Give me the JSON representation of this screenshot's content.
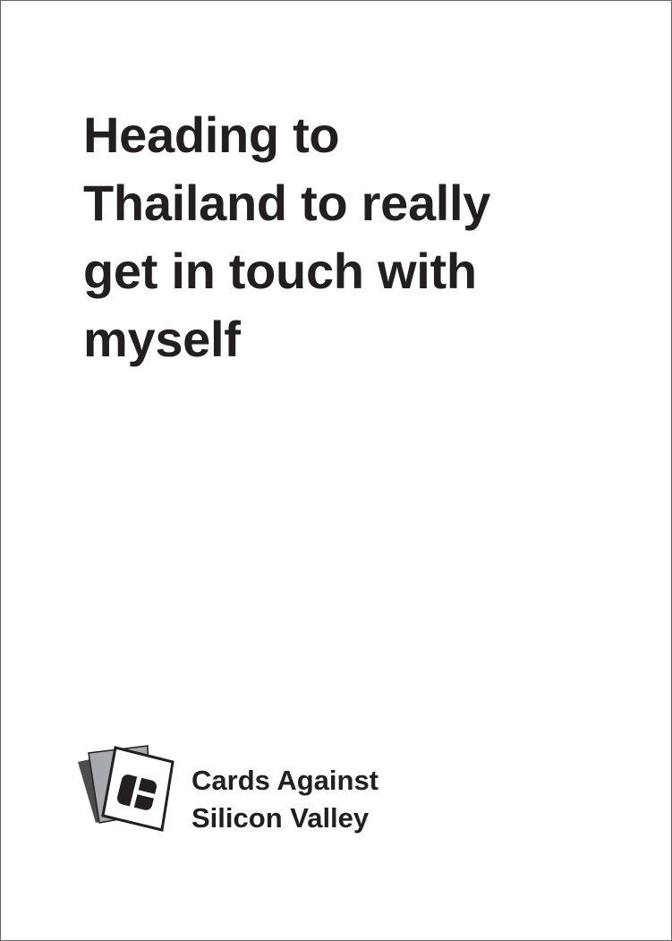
{
  "card": {
    "text_lines": [
      "Heading to",
      "Thailand to really",
      "get in touch with",
      "myself"
    ]
  },
  "brand": {
    "logo_icon": "stacked-cards-logo-icon",
    "line1": "Cards Against",
    "line2": "Silicon Valley"
  },
  "colors": {
    "text": "#231f20",
    "border": "#666666",
    "card_dark": "#4d4d4f",
    "card_mid": "#a7a9ac",
    "card_front": "#ffffff"
  }
}
